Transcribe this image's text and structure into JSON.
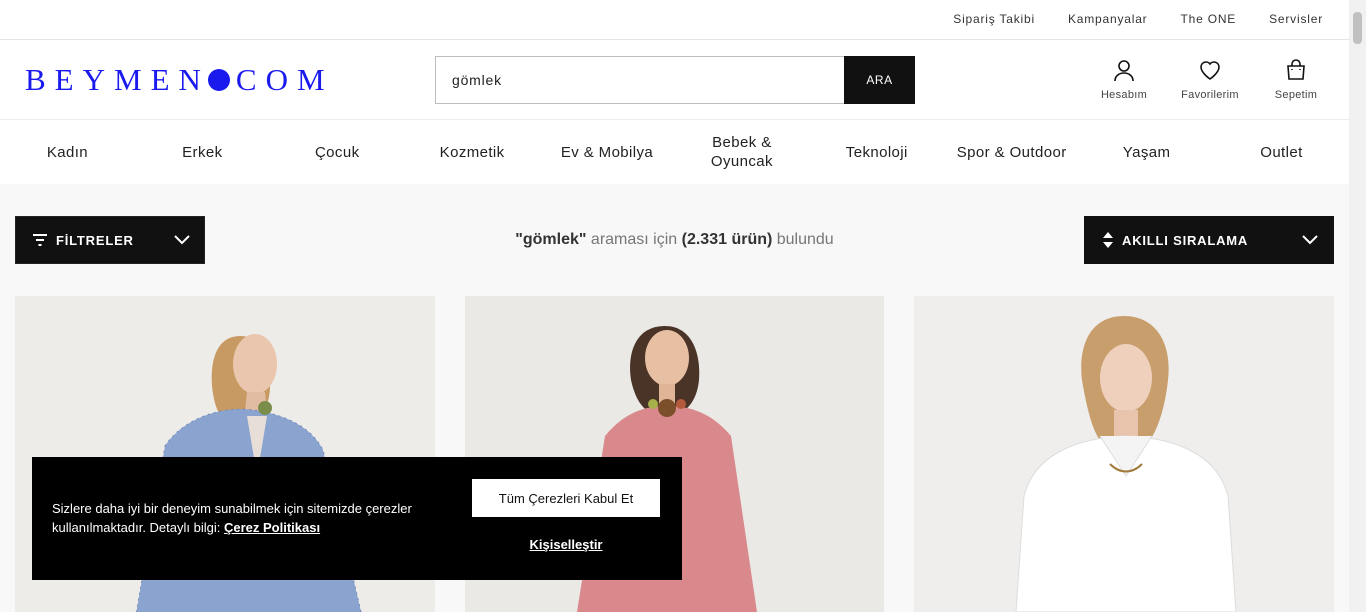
{
  "topbar": {
    "links": [
      "Sipariş Takibi",
      "Kampanyalar",
      "The ONE",
      "Servisler"
    ]
  },
  "header": {
    "logo_left": "BEYMEN",
    "logo_right": "COM",
    "search": {
      "value": "gömlek",
      "button": "ARA"
    },
    "icons": [
      {
        "label": "Hesabım",
        "icon": "user-icon"
      },
      {
        "label": "Favorilerim",
        "icon": "heart-icon"
      },
      {
        "label": "Sepetim",
        "icon": "shopping-bag-icon"
      }
    ]
  },
  "nav": [
    "Kadın",
    "Erkek",
    "Çocuk",
    "Kozmetik",
    "Ev & Mobilya",
    "Bebek & Oyuncak",
    "Teknoloji",
    "Spor & Outdoor",
    "Yaşam",
    "Outlet"
  ],
  "toolbar": {
    "filters_label": "FİLTRELER",
    "sort_label": "AKILLI SIRALAMA",
    "result_query": "\"gömlek\"",
    "result_mid": " araması için ",
    "result_count": "(2.331 ürün)",
    "result_end": " bulundu"
  },
  "cookie": {
    "message": "Sizlere daha iyi bir deneyim sunabilmek için sitemizde çerezler kullanılmaktadır. Detaylı bilgi: ",
    "policy_link": "Çerez Politikası",
    "accept": "Tüm Çerezleri Kabul Et",
    "customize": "Kişiselleştir"
  },
  "colors": {
    "brand": "#1a1aef",
    "dark": "#111111"
  }
}
